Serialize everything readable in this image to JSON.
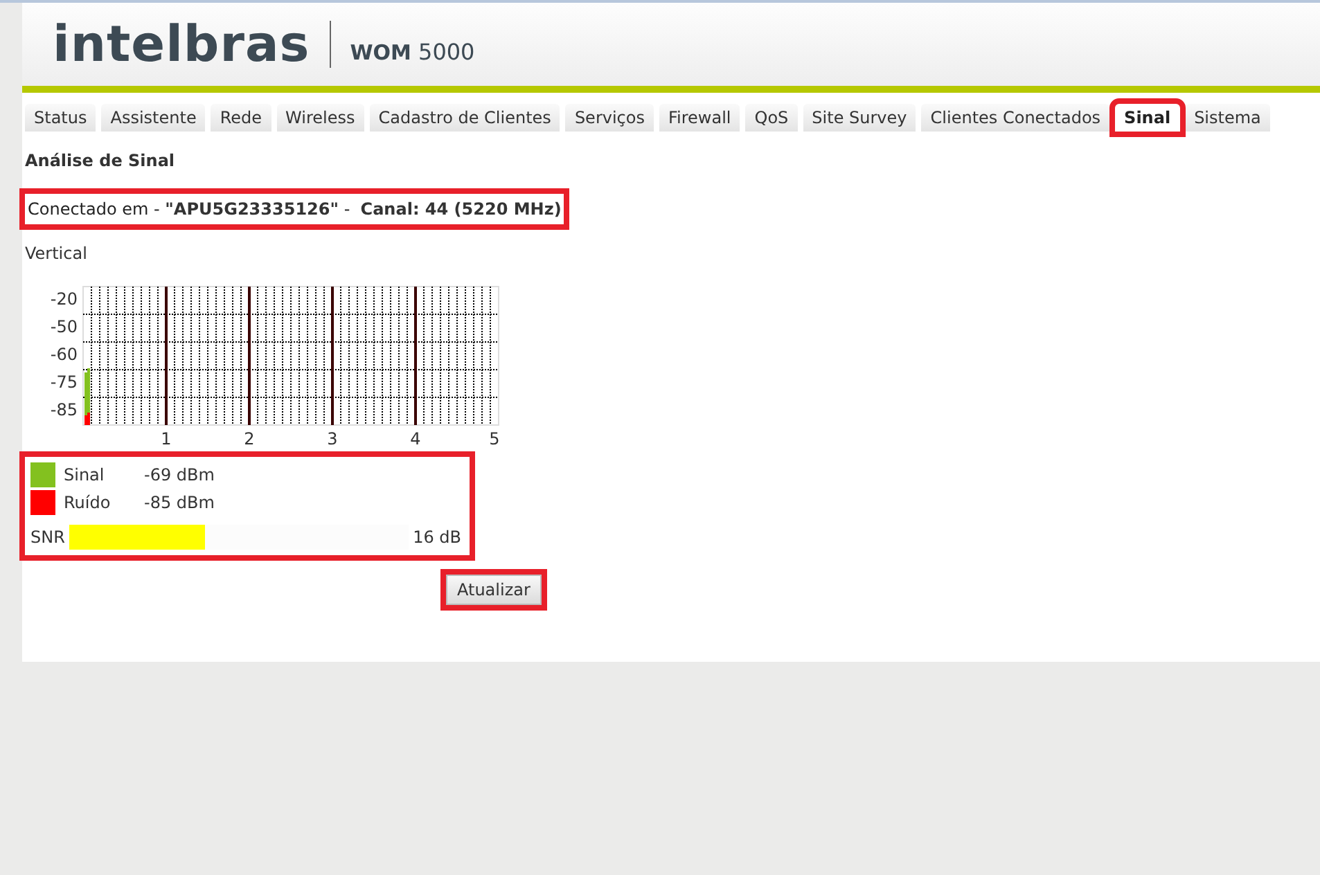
{
  "header": {
    "logo": "intelbras",
    "model_name": "WOM",
    "model_number": "5000"
  },
  "tabs": [
    {
      "label": "Status",
      "selected": false,
      "highlighted": false
    },
    {
      "label": "Assistente",
      "selected": false,
      "highlighted": false
    },
    {
      "label": "Rede",
      "selected": false,
      "highlighted": false
    },
    {
      "label": "Wireless",
      "selected": false,
      "highlighted": false
    },
    {
      "label": "Cadastro de Clientes",
      "selected": false,
      "highlighted": false
    },
    {
      "label": "Serviços",
      "selected": false,
      "highlighted": false
    },
    {
      "label": "Firewall",
      "selected": false,
      "highlighted": false
    },
    {
      "label": "QoS",
      "selected": false,
      "highlighted": false
    },
    {
      "label": "Site Survey",
      "selected": false,
      "highlighted": false
    },
    {
      "label": "Clientes Conectados",
      "selected": false,
      "highlighted": false
    },
    {
      "label": "Sinal",
      "selected": true,
      "highlighted": true
    },
    {
      "label": "Sistema",
      "selected": false,
      "highlighted": false
    }
  ],
  "section_title": "Análise de Sinal",
  "connection": {
    "text": "Conectado em - **\"APU5G23335126\"** -  **Canal: 44 (5220 MHz)**",
    "highlighted": true
  },
  "antenna": "Vertical",
  "graph": {
    "y_labels": [
      "-20",
      "-50",
      "-60",
      "-75",
      "-85"
    ],
    "x_labels": [
      "1",
      "2",
      "3",
      "4",
      "5"
    ]
  },
  "legend": {
    "highlighted": true,
    "items": [
      {
        "label": "Sinal",
        "value": "-69 dBm",
        "color": "#83c11f"
      },
      {
        "label": "Ruído",
        "value": "-85 dBm",
        "color": "#ff0000"
      }
    ],
    "snr": {
      "label": "SNR",
      "level": 0.4,
      "reading": "16 dB"
    }
  },
  "refresh_button": {
    "label": "Atualizar",
    "highlighted": true
  }
}
